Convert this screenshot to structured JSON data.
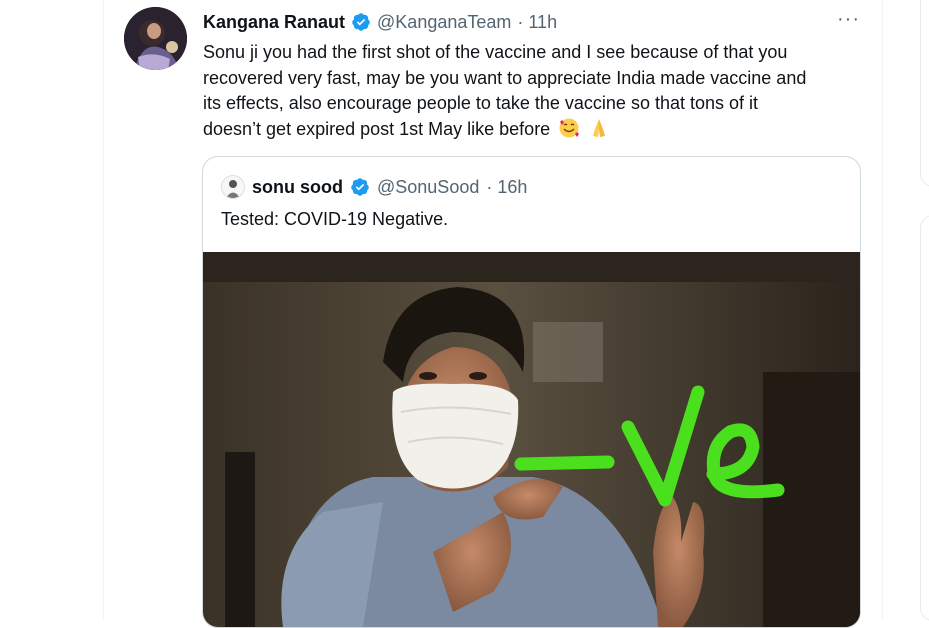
{
  "tweet": {
    "author_name": "Kangana Ranaut",
    "author_handle": "@KanganaTeam",
    "time": "· 11h",
    "more": "···",
    "text_lines": [
      "Sonu ji you had the first shot of the vaccine and I see because of that you",
      "recovered very fast, may be you want to appreciate India made vaccine and",
      "its effects, also encourage people to take the vaccine so that tons of it",
      "doesn’t get expired post 1st May like before"
    ],
    "emojis": [
      "smiling-face-with-hearts-icon",
      "folded-hands-icon"
    ]
  },
  "quoted_tweet": {
    "author_name": "sonu sood",
    "author_handle": "@SonuSood",
    "time": "· 16h",
    "text": "Tested: COVID-19 Negative.",
    "image_overlay_text": "-ve"
  },
  "colors": {
    "verified": "#1d9bf0",
    "secondary_text": "#536471",
    "border": "#cfd9de",
    "overlay_green": "#4be01e"
  }
}
